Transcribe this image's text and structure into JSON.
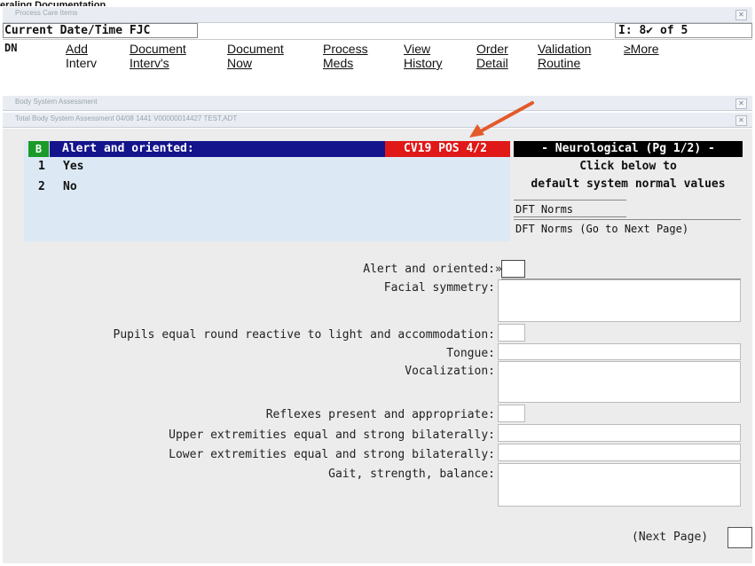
{
  "caption": "eraling Documentation",
  "outer_window": {
    "title": "Process Care Items",
    "close_label": "✕"
  },
  "header": {
    "field_value": "Current Date/Time FJC",
    "counter": "I: 8✔ of 5",
    "dn_label": "DN"
  },
  "menu": [
    {
      "line1": "Add",
      "line2": "Interv"
    },
    {
      "line1": "Document",
      "line2": "Interv's"
    },
    {
      "line1": "Document",
      "line2": "Now"
    },
    {
      "line1": "Process",
      "line2": "Meds"
    },
    {
      "line1": "View",
      "line2": "History"
    },
    {
      "line1": "Order",
      "line2": "Detail"
    },
    {
      "line1": "Validation",
      "line2": "Routine"
    },
    {
      "line1": "≥More",
      "line2": ""
    }
  ],
  "subwindow1": {
    "title": "Body System Assessment",
    "close_label": "✕"
  },
  "subwindow2": {
    "title": "Total Body System Assessment 04/08 1441    V00000014427 TEST,ADT",
    "close_label": "✕"
  },
  "prompt": {
    "badge": "B",
    "question": "Alert and oriented:",
    "alert": "CV19 POS 4/2",
    "options": [
      {
        "num": "1",
        "label": "Yes"
      },
      {
        "num": "2",
        "label": "No"
      }
    ]
  },
  "side_panel": {
    "header": "- Neurological (Pg 1/2) -",
    "line1": "Click below to",
    "line2": "default system normal values",
    "btn1": "DFT Norms",
    "btn2": "DFT Norms (Go to Next Page)"
  },
  "form": {
    "fields": [
      {
        "label": "Alert and oriented:",
        "marker": "»"
      },
      {
        "label": "Facial symmetry:"
      },
      {
        "label": "Pupils equal round reactive to light and accommodation:"
      },
      {
        "label": "Tongue:"
      },
      {
        "label": "Vocalization:"
      },
      {
        "label": "Reflexes present and appropriate:"
      },
      {
        "label": "Upper extremities equal and strong bilaterally:"
      },
      {
        "label": "Lower extremities equal and strong bilaterally:"
      },
      {
        "label": "Gait, strength, balance:"
      }
    ],
    "next_page": "(Next Page)"
  },
  "colors": {
    "prompt_bar": "#14148c",
    "alert_bg": "#e01818",
    "annotation_arrow": "#e35a2b",
    "panel_bg": "#dce9f5"
  }
}
